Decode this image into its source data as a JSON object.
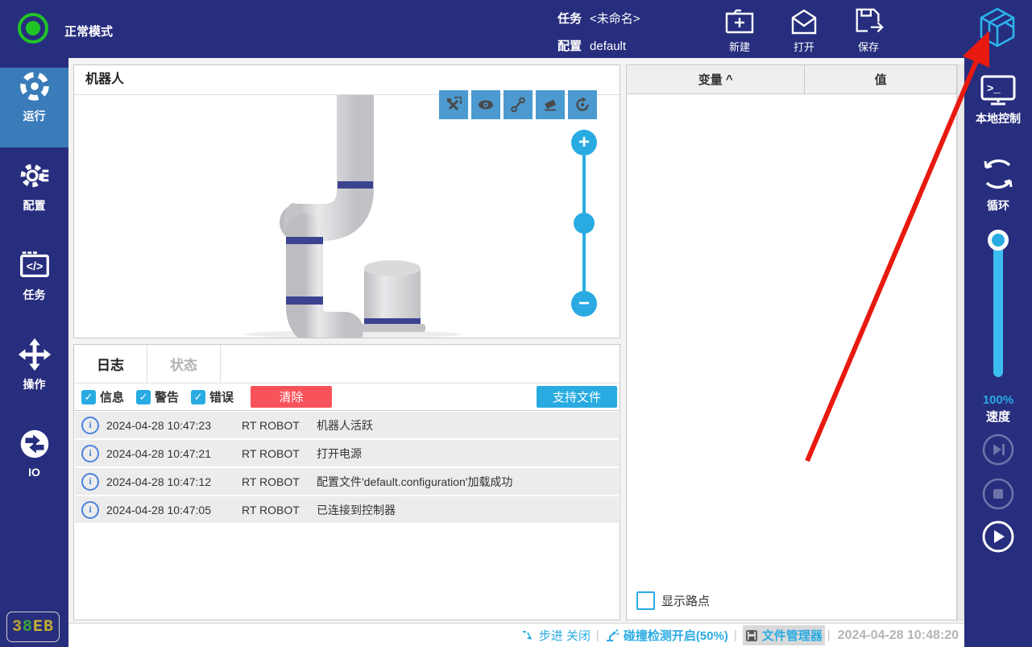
{
  "colors": {
    "navy": "#272e7e",
    "active_item_blue": "#3a7cba",
    "accent_cyan": "#29abe2",
    "tool_button_blue": "#4c9ad0",
    "danger_red": "#f8525a",
    "info_icon_blue": "#4a83e0",
    "annotation_arrow_red": "#e8190f",
    "status_green": "#20c427"
  },
  "top_bar": {
    "status_label": "正常模式",
    "task_label": "任务",
    "task_value": "<未命名>",
    "config_label": "配置",
    "config_value": "default",
    "actions": [
      {
        "label": "新建"
      },
      {
        "label": "打开"
      },
      {
        "label": "保存"
      }
    ]
  },
  "left_sidebar": {
    "items": [
      {
        "label": "运行",
        "active": true
      },
      {
        "label": "配置",
        "active": false
      },
      {
        "label": "任务",
        "active": false
      },
      {
        "label": "操作",
        "active": false
      },
      {
        "label": "IO",
        "active": false
      }
    ],
    "badge": {
      "text": "38EB",
      "chars": [
        {
          "ch": "3",
          "color": "#c2a42d"
        },
        {
          "ch": "8",
          "color": "#3fa33b"
        },
        {
          "ch": "E",
          "color": "#c8b42e"
        },
        {
          "ch": "B",
          "color": "#c2ac2e"
        }
      ]
    }
  },
  "robot_panel": {
    "title": "机器人"
  },
  "log_panel": {
    "tabs": [
      {
        "label": "日志",
        "active": true
      },
      {
        "label": "状态",
        "active": false
      }
    ],
    "filters": [
      {
        "label": "信息",
        "checked": true
      },
      {
        "label": "警告",
        "checked": true
      },
      {
        "label": "错误",
        "checked": true
      }
    ],
    "clear_label": "清除",
    "support_label": "支持文件",
    "entries": [
      {
        "time": "2024-04-28 10:47:23",
        "source": "RT ROBOT",
        "message": "机器人活跃"
      },
      {
        "time": "2024-04-28 10:47:21",
        "source": "RT ROBOT",
        "message": "打开电源"
      },
      {
        "time": "2024-04-28 10:47:12",
        "source": "RT ROBOT",
        "message": "配置文件'default.configuration'加载成功"
      },
      {
        "time": "2024-04-28 10:47:05",
        "source": "RT ROBOT",
        "message": "已连接到控制器"
      }
    ]
  },
  "variable_panel": {
    "col_variable": "变量",
    "sort_indicator": "^",
    "col_value": "值",
    "show_waypoints_label": "显示路点",
    "show_waypoints_checked": false
  },
  "right_sidebar": {
    "local_control_label": "本地控制",
    "loop_label": "循环",
    "speed_value": "100%",
    "speed_label": "速度"
  },
  "status_bar": {
    "step_label": "步进 关闭",
    "collision_label": "碰撞检测开启(50%)",
    "file_manager_label": "文件管理器",
    "datetime": "2024-04-28 10:48:20"
  }
}
